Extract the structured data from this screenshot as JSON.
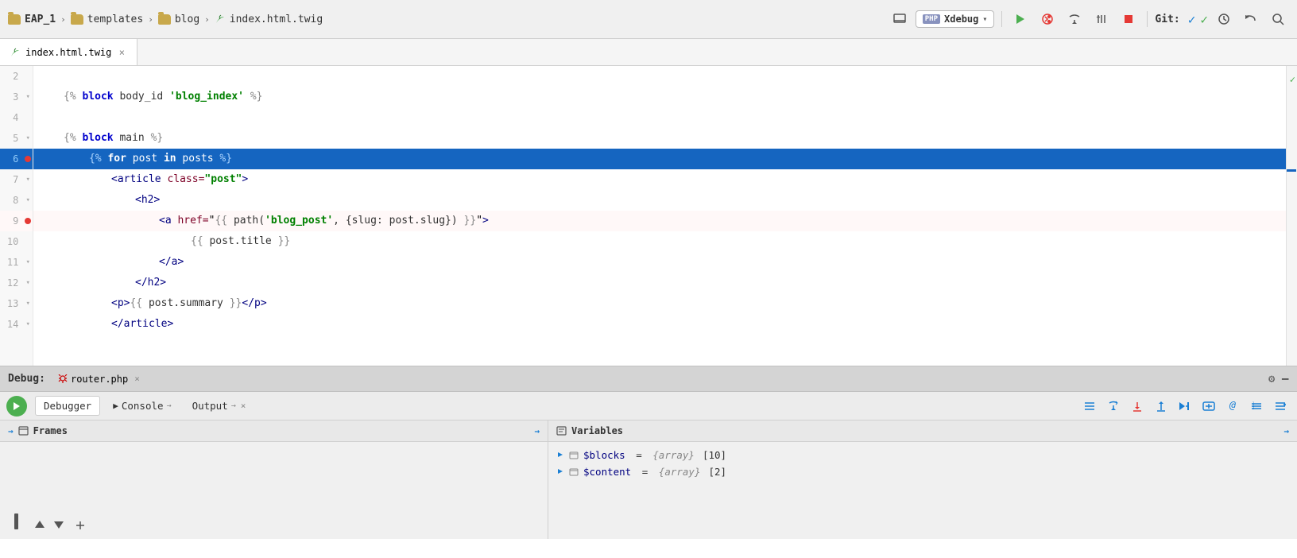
{
  "breadcrumb": {
    "project": "EAP_1",
    "folders": [
      "templates",
      "blog"
    ],
    "file": "index.html.twig"
  },
  "toolbar": {
    "xdebug_label": "Xdebug",
    "php_badge": "PHP",
    "git_label": "Git:"
  },
  "active_tab": {
    "filename": "index.html.twig"
  },
  "editor": {
    "lines": [
      {
        "num": 2,
        "content": "",
        "indent": 0
      },
      {
        "num": 3,
        "content": "{% block body_id 'blog_index' %}",
        "indent": 3
      },
      {
        "num": 4,
        "content": "",
        "indent": 0
      },
      {
        "num": 5,
        "content": "{% block main %}",
        "indent": 3
      },
      {
        "num": 6,
        "content": "{% for post in posts %}",
        "indent": 6,
        "highlight": true,
        "breakpoint": true
      },
      {
        "num": 7,
        "content": "<article class=\"post\">",
        "indent": 9
      },
      {
        "num": 8,
        "content": "<h2>",
        "indent": 12
      },
      {
        "num": 9,
        "content": "<a href=\"{{ path('blog_post', {slug: post.slug}) }}\">",
        "indent": 18,
        "breakpoint": true,
        "error": true
      },
      {
        "num": 10,
        "content": "{{ post.title }}",
        "indent": 24
      },
      {
        "num": 11,
        "content": "</a>",
        "indent": 18
      },
      {
        "num": 12,
        "content": "</h2>",
        "indent": 12
      },
      {
        "num": 13,
        "content": "<p>{{ post.summary }}</p>",
        "indent": 12
      },
      {
        "num": 14,
        "content": "</article>",
        "indent": 12
      }
    ]
  },
  "debug": {
    "title": "Debug:",
    "file": "router.php",
    "tabs": [
      {
        "label": "Debugger",
        "active": true
      },
      {
        "label": "Console",
        "active": false
      },
      {
        "label": "Output",
        "active": false
      }
    ],
    "frames_label": "Frames",
    "variables_label": "Variables",
    "variables": [
      {
        "name": "$blocks",
        "type": "{array}",
        "count": "[10]"
      },
      {
        "name": "$content",
        "type": "{array}",
        "count": "[2]"
      }
    ]
  }
}
